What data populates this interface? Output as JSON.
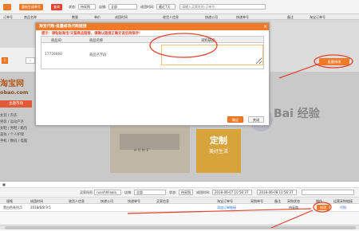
{
  "toolbar": {
    "btn1": "",
    "btn2": "重新生成单号",
    "btn3": "查询",
    "filter_label": "状态:",
    "filter_value": "待采购",
    "filter2_label": "店铺:",
    "filter2_value": "全部",
    "date_label": "成团时间:",
    "date_value": "最近7天",
    "search_placeholder": "请输入买家旺旺/订单号"
  },
  "header": {
    "cols": [
      "订单号",
      "商品名称",
      "数量",
      "单价",
      "成团时间",
      "收货人信息",
      "快递公司",
      "快递单号",
      "备注",
      "淘宝订单号"
    ]
  },
  "modal": {
    "title": "淘宝代购-批量修改代购链接",
    "warn": "提示：请粘贴淘宝/天猫商品链接，请确认链接正确无误后再保存！",
    "col_id": "商品ID",
    "col_name": "商品名称",
    "col_url": "采购链接",
    "row_id": "17716660",
    "row_name": "商品名字段",
    "ok": "确定",
    "cancel": "关闭"
  },
  "pager": {
    "page": "1",
    "next": "下一页"
  },
  "export_button": "批量修改",
  "taobao": {
    "logo": "淘宝网",
    "domain": "obao.com",
    "new_badge": "主题市场",
    "categories": [
      "女装 / 内衣",
      "男装 / 运动户外",
      "女鞋 / 男鞋 / 箱包",
      "美妆 / 个人护理",
      "手机 / 数码 / 电脑"
    ],
    "promo_big": "定制",
    "promo_small": "美好生活",
    "home": "HOME",
    "watermark": "Bai 经验"
  },
  "bottom": {
    "store_label": "买家旺旺:",
    "store_value": "ruanhhllaola",
    "shop_label": "店铺:",
    "shop_value": "全部",
    "status_label": "状态:",
    "status_value": "待采购",
    "time_label": "成团时间:",
    "time_from": "2018-06-07 10:56:37",
    "time_to": "2018-06-08 10:56:37",
    "cols": [
      "规格",
      "成团时间",
      "收货人信息",
      "快递公司",
      "快递单号",
      "买家信息",
      "淘宝订单号",
      "采购单号",
      "备注",
      "采购状态",
      "操作",
      "运营采购链接"
    ],
    "row": {
      "spec": "黑白色系列,5",
      "time": "2018/6/8 9:5",
      "tb_order": "添加订单链接",
      "status": "待采购",
      "action": "代购"
    },
    "modify": "修改"
  },
  "colors": {
    "accent": "#f07a28",
    "annotation": "#e3422f"
  }
}
